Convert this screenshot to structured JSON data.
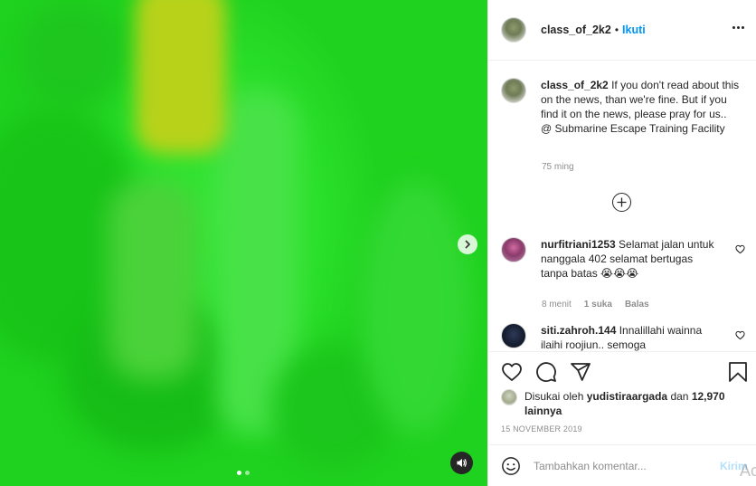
{
  "media": {
    "slides": 2,
    "current_slide": 1
  },
  "post": {
    "username": "class_of_2k2",
    "separator": "•",
    "follow_label": "Ikuti",
    "caption_user": "class_of_2k2",
    "caption_text": "If you don't read about this on the news, than we're fine. But if you find it on the news, please pray for us.. @ Submarine Escape Training Facility",
    "caption_time": "75 ming"
  },
  "comments": [
    {
      "username": "nurfitriani1253",
      "text": "Selamat jalan untuk nanggala 402 selamat bertugas tanpa batas 😭😭😭",
      "time": "8 menit",
      "likes": "1 suka",
      "reply_label": "Balas"
    },
    {
      "username": "siti.zahroh.144",
      "text": "Innalillahi wainna ilaihi roojiun.. semoga"
    }
  ],
  "likes": {
    "prefix": "Disukai oleh",
    "user": "yudistiraargada",
    "middle": "dan",
    "count": "12,970 lainnya"
  },
  "date": "15 NOVEMBER 2019",
  "add_comment": {
    "placeholder": "Tambahkan komentar...",
    "post_label": "Kirim"
  },
  "watermark": "Ac"
}
